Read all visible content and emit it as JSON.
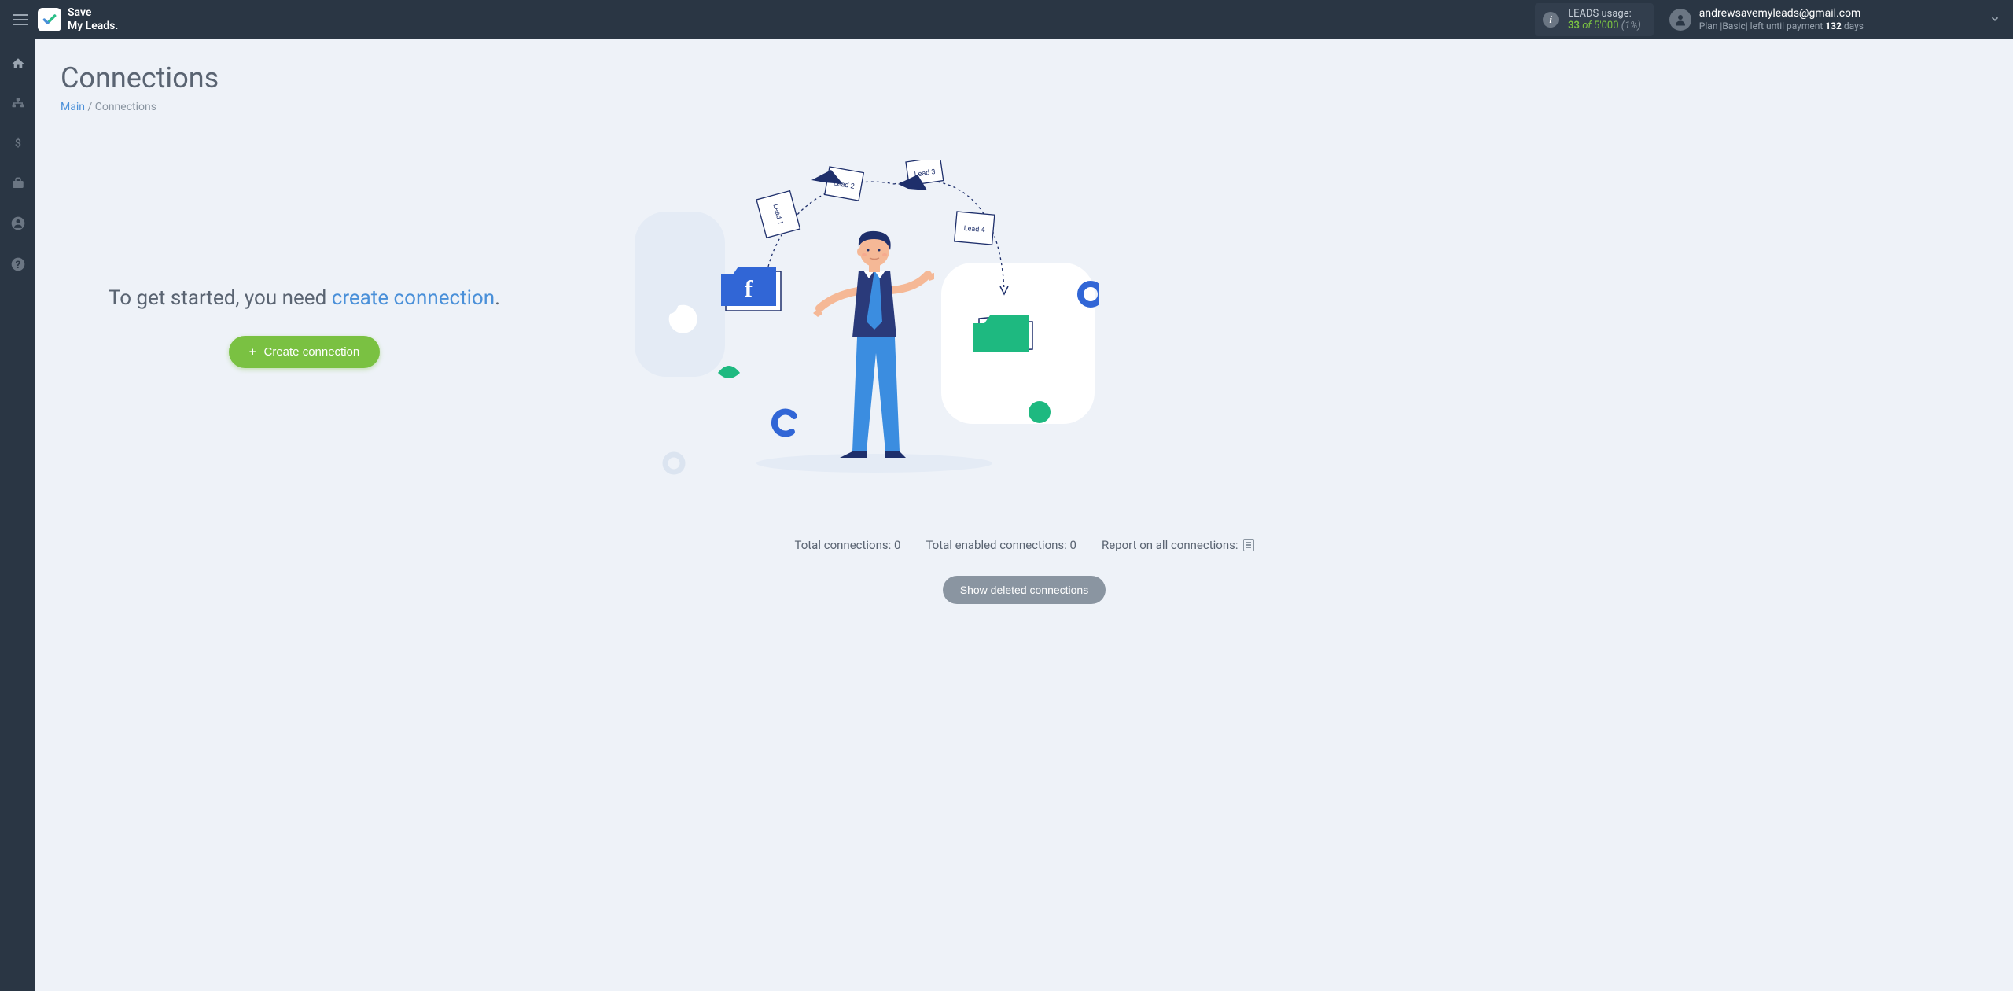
{
  "header": {
    "logo_line1": "Save",
    "logo_line2": "My Leads.",
    "leads": {
      "label": "LEADS usage:",
      "count": "33",
      "of": "of",
      "total": "5'000",
      "pct": "(1%)"
    },
    "user": {
      "email": "andrewsavemyleads@gmail.com",
      "plan_prefix": "Plan |",
      "plan_name": "Basic",
      "plan_mid": "| left until payment ",
      "days_remaining": "132",
      "plan_suffix": " days"
    }
  },
  "page": {
    "title": "Connections",
    "breadcrumb_main": "Main",
    "breadcrumb_sep": " / ",
    "breadcrumb_current": "Connections"
  },
  "empty": {
    "text_before": "To get started, you need ",
    "link_text": "create connection",
    "text_after": ".",
    "button": "Create connection"
  },
  "stats": {
    "total_label": "Total connections: ",
    "total_value": "0",
    "enabled_label": "Total enabled connections: ",
    "enabled_value": "0",
    "report_label": "Report on all connections: "
  },
  "illustration": {
    "lead1": "Lead 1",
    "lead2": "Lead 2",
    "lead3": "Lead 3",
    "lead4": "Lead 4",
    "fb": "f"
  },
  "buttons": {
    "show_deleted": "Show deleted connections"
  }
}
